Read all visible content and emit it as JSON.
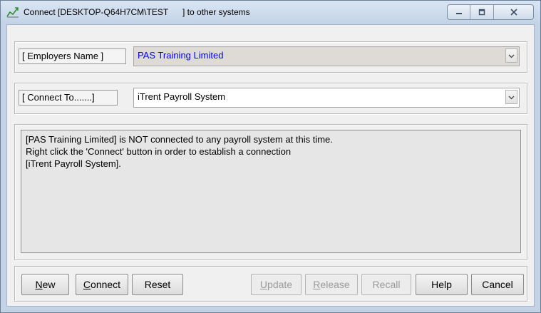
{
  "window": {
    "title": "Connect [DESKTOP-Q64H7CM\\TEST      ] to other systems"
  },
  "employer": {
    "label": "[ Employers Name ]",
    "value": "PAS Training Limited"
  },
  "connect_to": {
    "label": "[ Connect To.......]",
    "value": "iTrent Payroll System"
  },
  "message": {
    "lines": [
      "[PAS Training Limited] is NOT connected to any payroll system at this time.",
      "Right click the 'Connect' button in order to establish a connection",
      "[iTrent Payroll System]."
    ]
  },
  "buttons": {
    "new": {
      "mnemonic": "N",
      "rest": "ew"
    },
    "connect": {
      "mnemonic": "C",
      "rest": "onnect"
    },
    "reset": "Reset",
    "update": {
      "mnemonic": "U",
      "rest": "pdate"
    },
    "release": {
      "mnemonic": "R",
      "rest": "elease"
    },
    "recall": "Recall",
    "help": "Help",
    "cancel": "Cancel"
  },
  "colors": {
    "employer_text": "#0000ee",
    "disabled_text": "#9a9a9a"
  },
  "icons": {
    "app": "chart-line-icon",
    "minimize": "minimize-icon",
    "maximize": "maximize-icon",
    "close": "close-icon",
    "dropdown": "chevron-down-icon"
  }
}
